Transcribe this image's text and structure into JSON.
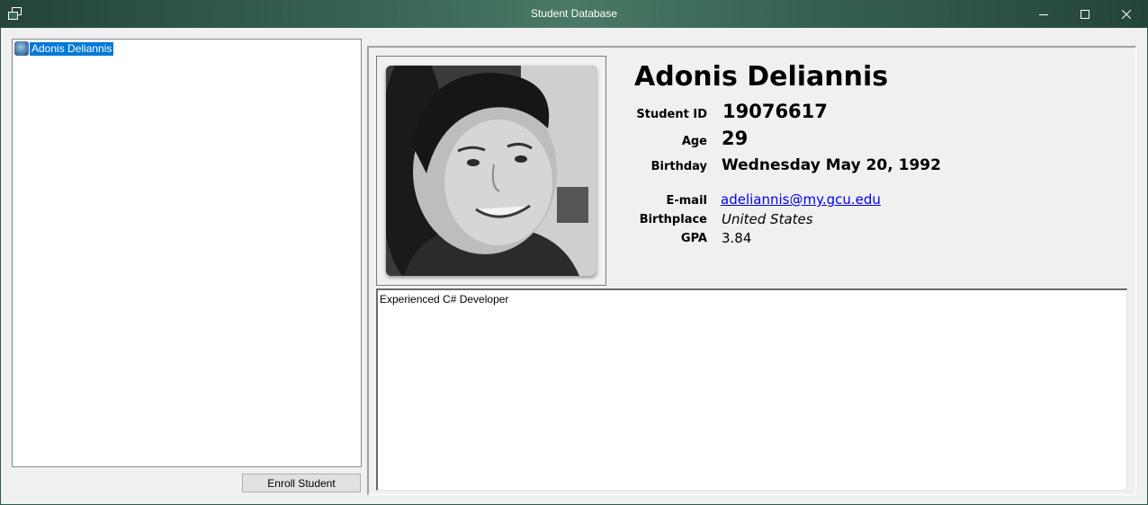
{
  "window": {
    "title": "Student Database",
    "icon": "restore-window-icon",
    "controls": [
      "minimize-icon",
      "maximize-icon",
      "close-icon"
    ]
  },
  "student_list": {
    "items": [
      {
        "label": "Adonis Deliannis",
        "icon": "student-avatar-icon",
        "selected": true
      }
    ]
  },
  "enroll_button": {
    "label": "Enroll Student"
  },
  "student": {
    "name": "Adonis Deliannis",
    "labels": {
      "student_id": "Student ID",
      "age": "Age",
      "birthday": "Birthday",
      "email": "E-mail",
      "birthplace": "Birthplace",
      "gpa": "GPA"
    },
    "student_id": "19076617",
    "age": "29",
    "birthday": "Wednesday May 20, 1992",
    "email": "adeliannis@my.gcu.edu",
    "birthplace": "United States",
    "gpa": "3.84",
    "bio": "Experienced C# Developer",
    "photo": "student-photo"
  },
  "colors": {
    "titlebar": "#3a6756",
    "selection": "#0078d7",
    "link": "#0000ee"
  }
}
